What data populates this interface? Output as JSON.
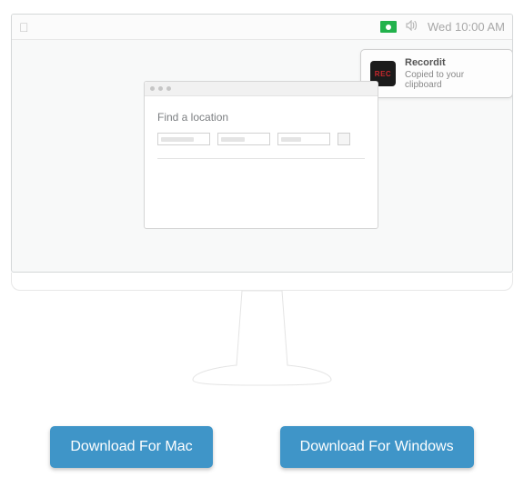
{
  "menubar": {
    "clock": "Wed 10:00 AM"
  },
  "notification": {
    "icon_label": "REC",
    "title": "Recordit",
    "message": "Copied to your clipboard"
  },
  "app_window": {
    "find_label": "Find a location"
  },
  "buttons": {
    "mac": "Download For Mac",
    "windows": "Download For Windows"
  }
}
